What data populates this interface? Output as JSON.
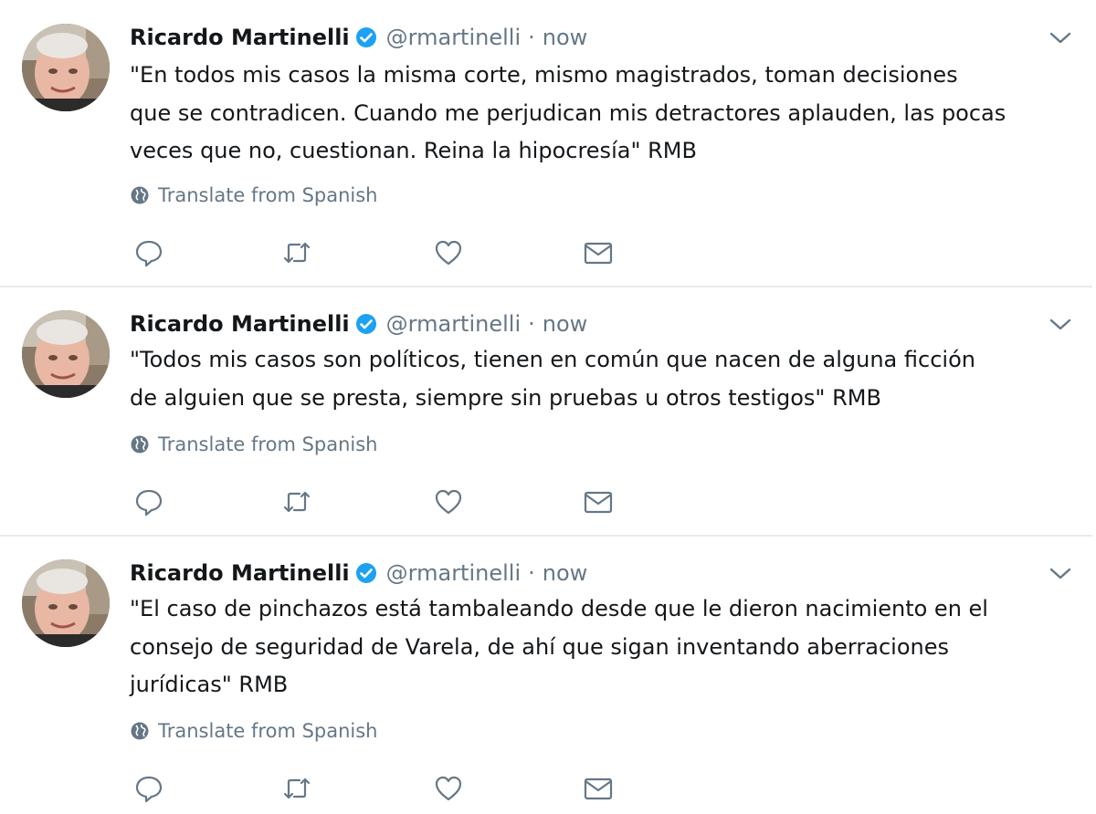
{
  "colors": {
    "name": "#14171a",
    "secondary": "#657786",
    "verified": "#1da1f2",
    "divider": "#e6ecf0",
    "background": "#ffffff"
  },
  "icons": {
    "verified": "verified-badge-icon",
    "caret": "chevron-down-icon",
    "translate": "globe-icon",
    "reply": "reply-icon",
    "retweet": "retweet-icon",
    "like": "heart-icon",
    "dm": "envelope-icon"
  },
  "tweets": [
    {
      "name": "Ricardo Martinelli",
      "handle": "@rmartinelli",
      "separator": "·",
      "time": "now",
      "text": "\"En todos mis casos la misma corte, mismo magistrados, toman decisiones\nque se contradicen. Cuando me perjudican mis detractores aplauden, las pocas\nveces que no, cuestionan. Reina la hipocresía\" RMB",
      "translate_label": "Translate from Spanish"
    },
    {
      "name": "Ricardo Martinelli",
      "handle": "@rmartinelli",
      "separator": "·",
      "time": "now",
      "text": "\"Todos mis casos son políticos, tienen en común que nacen de alguna ficción\nde alguien que se presta, siempre sin pruebas u otros testigos\" RMB",
      "translate_label": "Translate from Spanish"
    },
    {
      "name": "Ricardo Martinelli",
      "handle": "@rmartinelli",
      "separator": "·",
      "time": "now",
      "text": "\"El caso de pinchazos está tambaleando desde que le dieron nacimiento en el\nconsejo de seguridad de Varela, de ahí que sigan inventando aberraciones\njurídicas\" RMB",
      "translate_label": "Translate from Spanish"
    }
  ]
}
